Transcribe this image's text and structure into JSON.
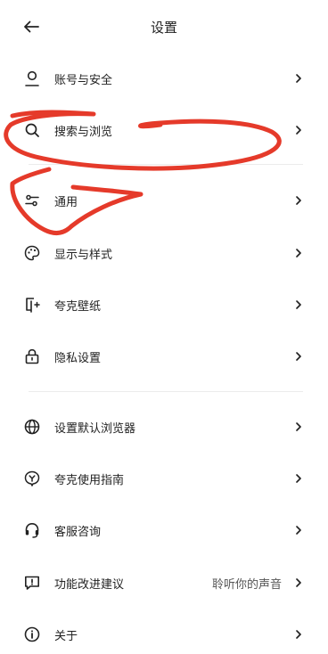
{
  "header": {
    "title": "设置",
    "back_icon": "arrow-left-icon"
  },
  "menu": [
    {
      "id": "account",
      "label": "账号与安全",
      "icon": "user-icon"
    },
    {
      "id": "search",
      "label": "搜索与浏览",
      "icon": "search-icon"
    },
    {
      "id": "general",
      "label": "通用",
      "icon": "sliders-icon"
    },
    {
      "id": "display",
      "label": "显示与样式",
      "icon": "palette-icon"
    },
    {
      "id": "wallpaper",
      "label": "夸克壁纸",
      "icon": "wallpaper-icon"
    },
    {
      "id": "privacy",
      "label": "隐私设置",
      "icon": "lock-icon"
    },
    {
      "id": "default-browser",
      "label": "设置默认浏览器",
      "icon": "globe-icon"
    },
    {
      "id": "guide",
      "label": "夸克使用指南",
      "icon": "guide-icon"
    },
    {
      "id": "support",
      "label": "客服咨询",
      "icon": "headset-icon"
    },
    {
      "id": "feedback",
      "label": "功能改进建议",
      "icon": "feedback-icon",
      "hint": "聆听你的声音"
    },
    {
      "id": "about",
      "label": "关于",
      "icon": "info-icon"
    }
  ],
  "colors": {
    "annotation_stroke": "#e53a2a",
    "divider": "#ececec",
    "text": "#222222"
  }
}
